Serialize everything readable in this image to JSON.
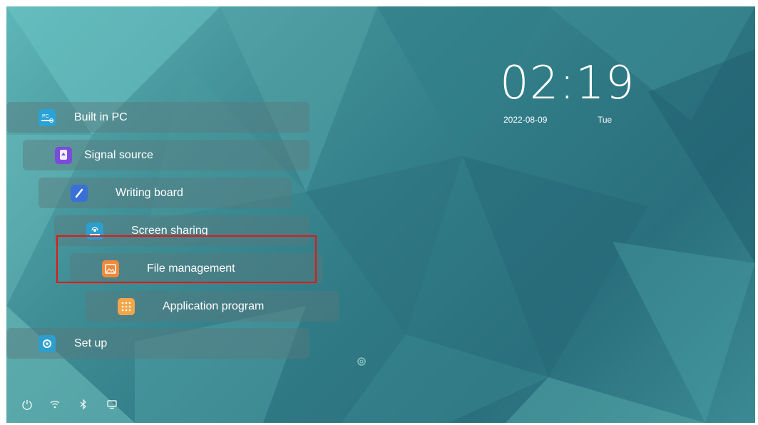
{
  "clock": {
    "time": "02:19",
    "date": "2022-08-09",
    "day": "Tue"
  },
  "menu": [
    {
      "key": "pc",
      "label": "Built in PC",
      "icon": "pc-icon",
      "color": "#2aa3d8"
    },
    {
      "key": "signal",
      "label": "Signal source",
      "icon": "signal-source-icon",
      "color": "#7b4bd9"
    },
    {
      "key": "writing",
      "label": "Writing board",
      "icon": "writing-board-icon",
      "color": "#3b6fd8"
    },
    {
      "key": "screen",
      "label": "Screen sharing",
      "icon": "screen-sharing-icon",
      "color": "#2c9fcf"
    },
    {
      "key": "file",
      "label": "File management",
      "icon": "file-management-icon",
      "color": "#f08a3a",
      "highlighted": true
    },
    {
      "key": "apps",
      "label": "Application program",
      "icon": "application-program-icon",
      "color": "#f2a64a"
    },
    {
      "key": "setup",
      "label": "Set up",
      "icon": "setup-icon",
      "color": "#2c9fcf"
    }
  ],
  "status_bar": [
    "power-icon",
    "wifi-icon",
    "bluetooth-icon",
    "display-icon"
  ],
  "center_icon": "settings-gear-icon",
  "colors": {
    "highlight": "#e01818"
  }
}
